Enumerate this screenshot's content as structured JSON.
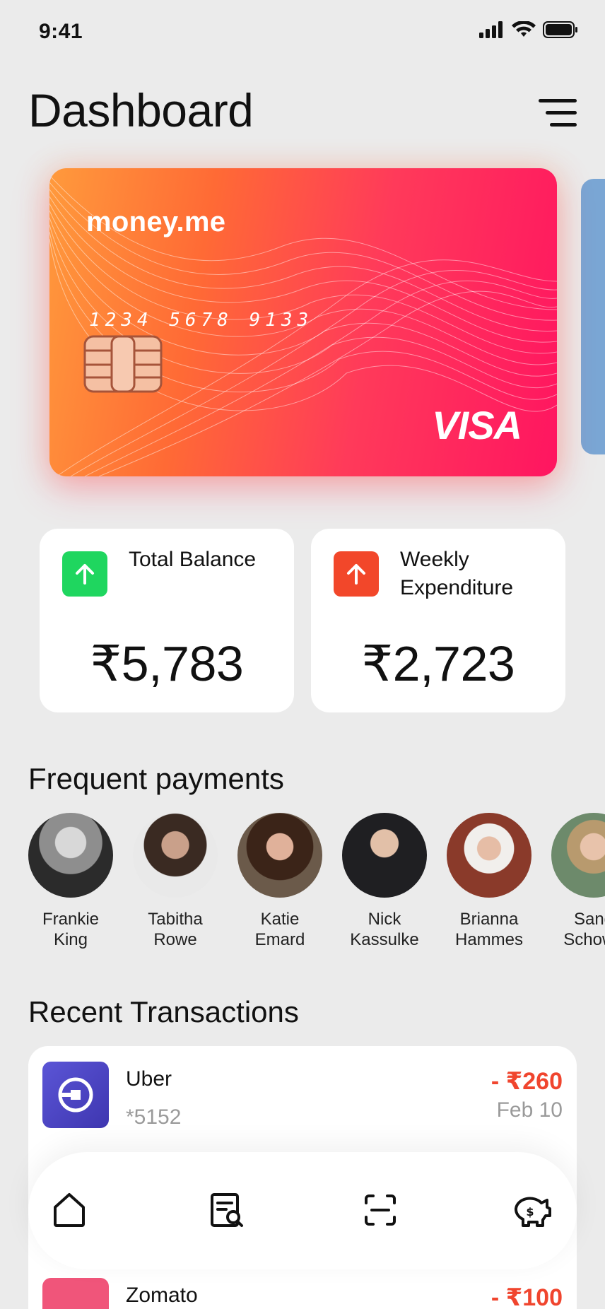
{
  "status": {
    "time": "9:41"
  },
  "header": {
    "title": "Dashboard"
  },
  "card": {
    "brand": "money.me",
    "number": "1234 5678 9133",
    "network": "VISA"
  },
  "stats": [
    {
      "label": "Total Balance",
      "value": "₹5,783",
      "direction": "up",
      "color": "#1fd65f"
    },
    {
      "label": "Weekly Expenditure",
      "value": "₹2,723",
      "direction": "up",
      "color": "#f2472a"
    }
  ],
  "frequent": {
    "title": "Frequent payments",
    "contacts": [
      {
        "first": "Frankie",
        "last": "King"
      },
      {
        "first": "Tabitha",
        "last": "Rowe"
      },
      {
        "first": "Katie",
        "last": "Emard"
      },
      {
        "first": "Nick",
        "last": "Kassulke"
      },
      {
        "first": "Brianna",
        "last": "Hammes"
      },
      {
        "first": "Sand",
        "last": "Schowa"
      }
    ]
  },
  "transactions": {
    "title": "Recent Transactions",
    "items": [
      {
        "name": "Uber",
        "sub": "*5152",
        "amount": "- ₹260",
        "date": "Feb 10"
      },
      {
        "name": "Zomato",
        "sub": "",
        "amount": "- ₹100",
        "date": ""
      }
    ]
  },
  "nav": {
    "items": [
      "home-icon",
      "receipt-search-icon",
      "scan-icon",
      "piggy-bank-icon"
    ]
  },
  "colors": {
    "accent_green": "#1fd65f",
    "accent_red": "#f2472a",
    "card_gradient_start": "#ff9a3c",
    "card_gradient_end": "#ff1560"
  }
}
